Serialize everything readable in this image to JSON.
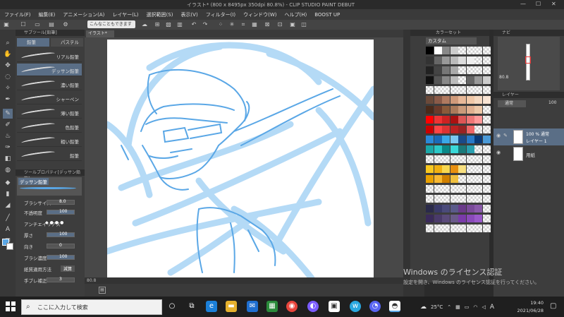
{
  "title": "イラスト* (800 x 8495px 350dpi 80.8%) - CLIP STUDIO PAINT DEBUT",
  "menu": [
    "ファイル(F)",
    "編集(E)",
    "アニメーション(A)",
    "レイヤー(L)",
    "選択範囲(S)",
    "表示(V)",
    "フィルター(I)",
    "ウィンドウ(W)",
    "ヘルプ(H)",
    "BOOST UP"
  ],
  "toolbar": {
    "hint": "こんなこともできます"
  },
  "subtool": {
    "header": "サブツール[鉛筆]",
    "tabs": [
      "鉛筆",
      "パステル"
    ],
    "brushes": [
      "リアル鉛筆",
      "デッサン鉛筆",
      "濃い鉛筆",
      "シャーペン",
      "薄い鉛筆",
      "色鉛筆",
      "粗い鉛筆",
      "鉛筆"
    ]
  },
  "toolprop": {
    "header": "ツールプロパティ[デッサン鉛筆]",
    "name": "デッサン鉛筆",
    "props": [
      {
        "label": "ブラシサイズ",
        "value": "8.0"
      },
      {
        "label": "不透明度",
        "value": "100"
      },
      {
        "label": "アンチエイリアス",
        "value": ""
      },
      {
        "label": "厚さ",
        "value": "100"
      },
      {
        "label": "向き",
        "value": "0"
      },
      {
        "label": "ブラシ濃度",
        "value": "100"
      },
      {
        "label": "紙質適用方法",
        "value": "減算"
      },
      {
        "label": "手ブレ補正",
        "value": "3"
      }
    ]
  },
  "canvas": {
    "tab": "イラスト*",
    "zoom": "80.8"
  },
  "colorset": {
    "header": "カラーセット",
    "selector": "カスタム"
  },
  "navigator": {
    "header": "ナビ",
    "zoom": "80.8"
  },
  "layers": {
    "header": "レイヤー",
    "blend": "通常",
    "opacity": "100",
    "items": [
      {
        "meta": "100 % 通常",
        "name": "レイヤー 1"
      },
      {
        "meta": "",
        "name": "用紙"
      }
    ]
  },
  "watermark": {
    "line1": "Windows のライセンス認証",
    "line2": "設定を開き、Windows のライセンス認証を行ってください。"
  },
  "taskbar": {
    "search_placeholder": "ここに入力して検索",
    "temp": "25°C",
    "ime": "A",
    "time": "19:40",
    "date": "2021/06/28"
  },
  "colors": {
    "accent": "#5aa7e6",
    "sketch": "#a8d4f5"
  }
}
